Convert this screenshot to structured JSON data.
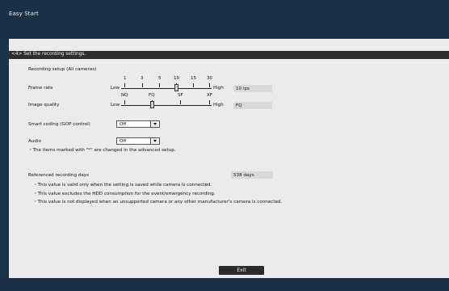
{
  "window": {
    "title": "Easy Start"
  },
  "section": {
    "header": "<4> Set the recording settings."
  },
  "recording_setup": {
    "heading": "Recording setup (All cameras)",
    "frame_rate": {
      "label": "Frame rate",
      "low_label": "Low",
      "high_label": "High",
      "ticks": [
        "1",
        "3",
        "5",
        "10",
        "15",
        "30"
      ],
      "value": "10 ips",
      "selected_index": 3
    },
    "image_quality": {
      "label": "Image quality",
      "low_label": "Low",
      "high_label": "High",
      "ticks": [
        "NQ",
        "FQ",
        "SF",
        "XF"
      ],
      "value": "FQ",
      "selected_index": 1
    },
    "smart_coding": {
      "label": "Smart coding (GOP control)",
      "value": "Off"
    },
    "audio": {
      "label": "Audio",
      "value": "Off"
    },
    "note": "・The items marked with \"*\" are changed in the advanced setup."
  },
  "referenced_days": {
    "label": "Referenced recording days",
    "value": "538 days",
    "notes": [
      "・This value is valid only when the setting is saved while camera is connected.",
      "・This value excludes the HDD consumption for the event/emergency recording.",
      "・This value is not displayed when an unsupported camera or any other manufacturer's camera is connected."
    ]
  },
  "buttons": {
    "exit": "Exit"
  },
  "colors": {
    "window_bg": "#1c3249",
    "panel_bg": "#ebebeb",
    "section_bar": "#2e2e2e",
    "button": "#2b2b2b"
  }
}
